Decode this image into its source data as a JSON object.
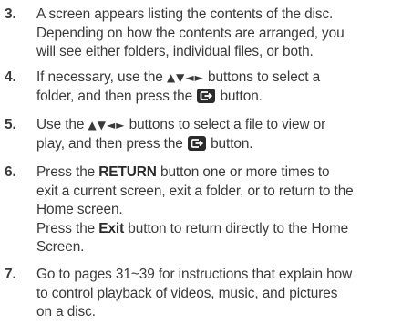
{
  "steps": [
    {
      "num": "3.",
      "lines": [
        "A screen appears listing the contents of the disc.",
        "Depending on how the contents are arranged, you",
        "will see either folders, individual files, or both."
      ]
    },
    {
      "num": "4.",
      "line1_pre": "If necessary, use the ",
      "arrows": "▲▼◄►",
      "line1_post": " buttons to select a",
      "line2_pre": "folder, and then press the ",
      "line2_post": " button."
    },
    {
      "num": "5.",
      "line1_pre": "Use the ",
      "arrows": "▲▼◄►",
      "line1_post": " buttons to select a file to view or",
      "line2_pre": "play, and then press the ",
      "line2_post": " button."
    },
    {
      "num": "6.",
      "p1_pre": "Press the ",
      "p1_bold": "RETURN",
      "p1_post": " button one or more times to",
      "p1_line2": "exit a current screen, exit a folder, or to return to the",
      "p1_line3": "Home screen.",
      "p2_pre": "Press the ",
      "p2_bold": "Exit",
      "p2_post": " button to return directly to the Home",
      "p2_line2": "Screen."
    },
    {
      "num": "7.",
      "lines": [
        "Go to pages 31~39 for instructions that explain how",
        "to control playback of videos, music, and pictures",
        "on a disc."
      ]
    }
  ],
  "enter_key_icon": "enter-key-icon",
  "colors": {
    "text": "#3a3a3a",
    "icon_bg": "#2b2b2b",
    "icon_fg": "#ffffff"
  }
}
